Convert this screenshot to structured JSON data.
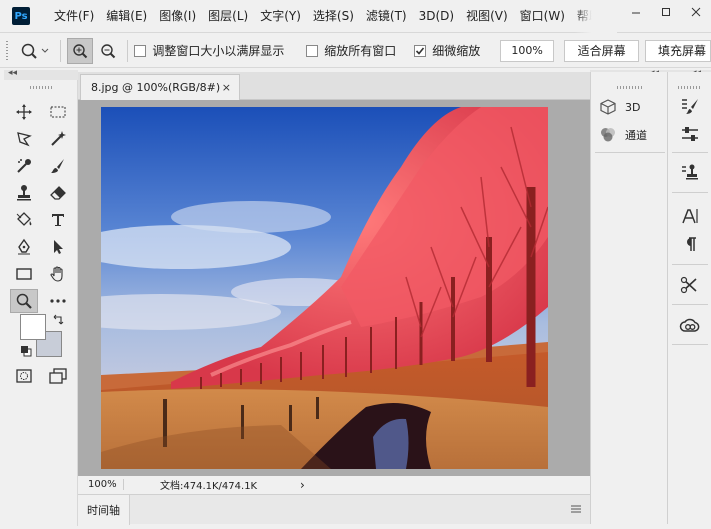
{
  "app": {
    "logo_text": "Ps"
  },
  "menu": {
    "items": [
      "文件(F)",
      "编辑(E)",
      "图像(I)",
      "图层(L)",
      "文字(Y)",
      "选择(S)",
      "滤镜(T)",
      "3D(D)",
      "视图(V)",
      "窗口(W)",
      "帮助"
    ]
  },
  "options": {
    "resize_windows_label": "调整窗口大小以满屏显示",
    "resize_windows_checked": false,
    "zoom_all_label": "缩放所有窗口",
    "zoom_all_checked": false,
    "scrubby_label": "细微缩放",
    "scrubby_checked": true,
    "zoom_value": "100%",
    "fit_screen_label": "适合屏幕",
    "fill_screen_label": "填充屏幕"
  },
  "document": {
    "tab_title": "8.jpg @ 100%(RGB/8#)",
    "close_symbol": "×",
    "status_zoom": "100%",
    "status_doc": "文档:474.1K/474.1K",
    "status_arrow": "›"
  },
  "timeline": {
    "label": "时间轴"
  },
  "panels": {
    "items": [
      {
        "label": "3D",
        "icon": "cube-icon"
      },
      {
        "label": "通道",
        "icon": "channels-icon"
      }
    ]
  },
  "colors": {
    "foreground": "#ffffff",
    "background": "#c8cdd8"
  }
}
